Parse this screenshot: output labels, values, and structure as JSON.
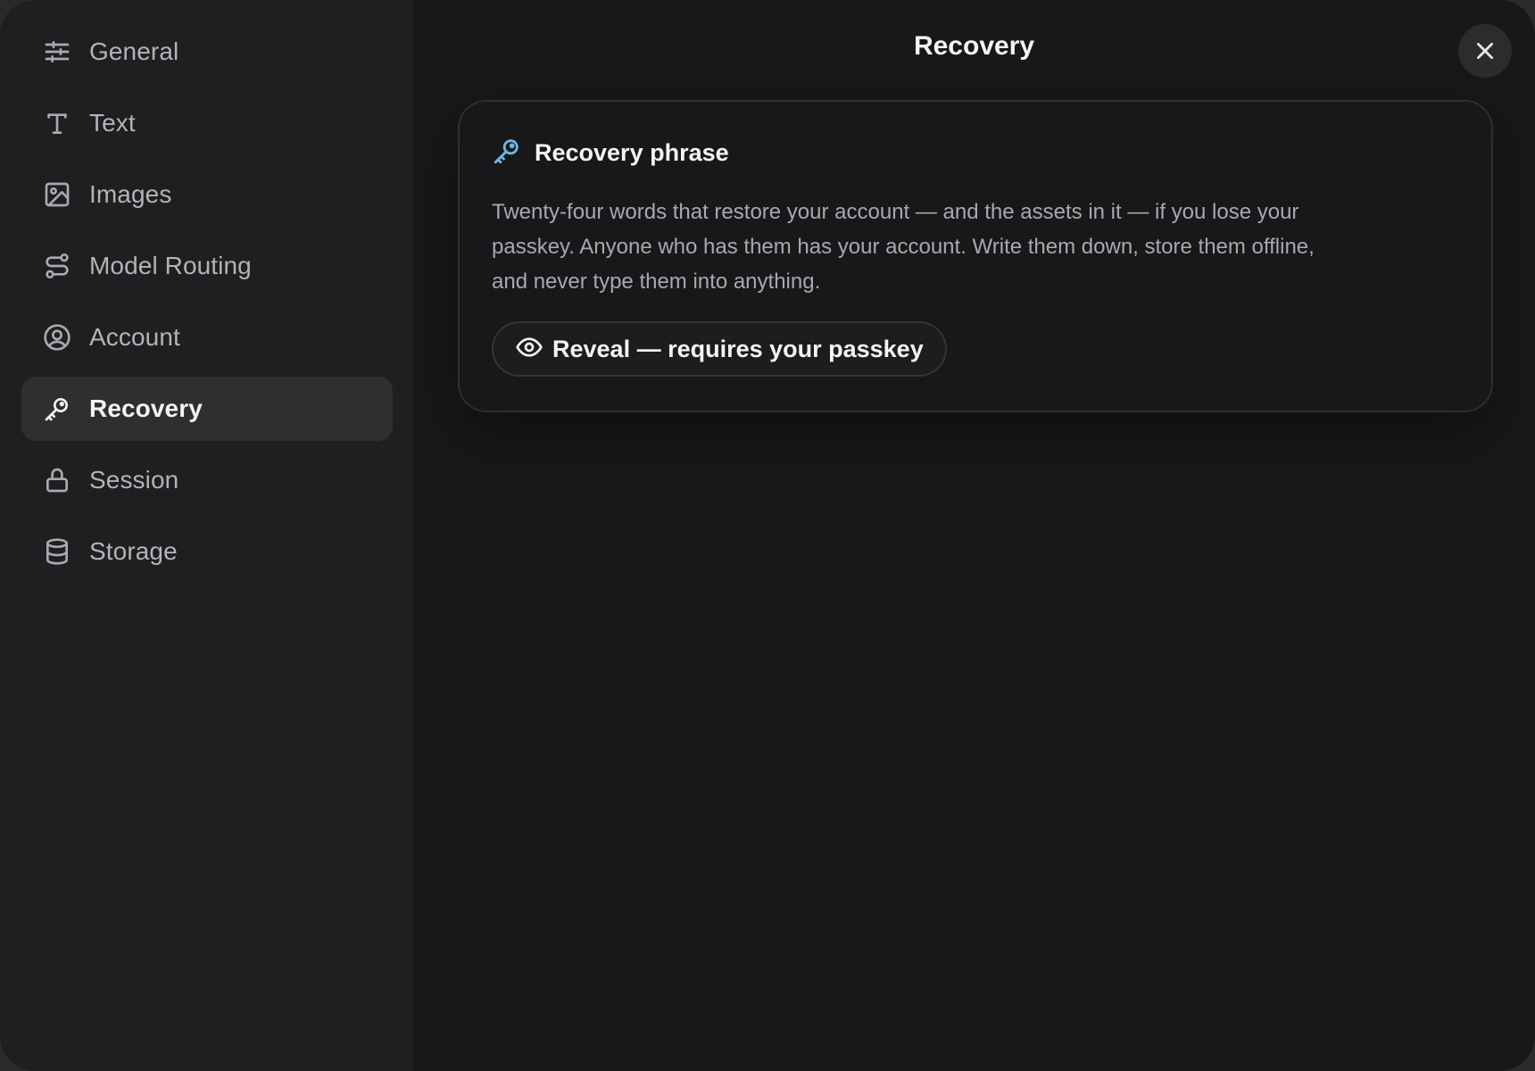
{
  "sidebar": {
    "items": [
      {
        "label": "General",
        "icon": "sliders-icon",
        "active": false
      },
      {
        "label": "Text",
        "icon": "text-icon",
        "active": false
      },
      {
        "label": "Images",
        "icon": "image-icon",
        "active": false
      },
      {
        "label": "Model Routing",
        "icon": "route-icon",
        "active": false
      },
      {
        "label": "Account",
        "icon": "user-circle-icon",
        "active": false
      },
      {
        "label": "Recovery",
        "icon": "key-icon",
        "active": true
      },
      {
        "label": "Session",
        "icon": "lock-icon",
        "active": false
      },
      {
        "label": "Storage",
        "icon": "database-icon",
        "active": false
      }
    ]
  },
  "header": {
    "title": "Recovery",
    "close_icon": "close-icon"
  },
  "card": {
    "icon": "key-icon",
    "title": "Recovery phrase",
    "description": "Twenty-four words that restore your account — and the assets in it — if you lose your passkey. Anyone who has them has your account. Write them down, store them offline, and never type them into anything.",
    "button_label": "Reveal — requires your passkey",
    "button_icon": "eye-icon"
  },
  "colors": {
    "accent": "#6fb6e6",
    "background": "#18181a",
    "sidebar": "#1f1f21",
    "active_item": "#2f2f32"
  }
}
